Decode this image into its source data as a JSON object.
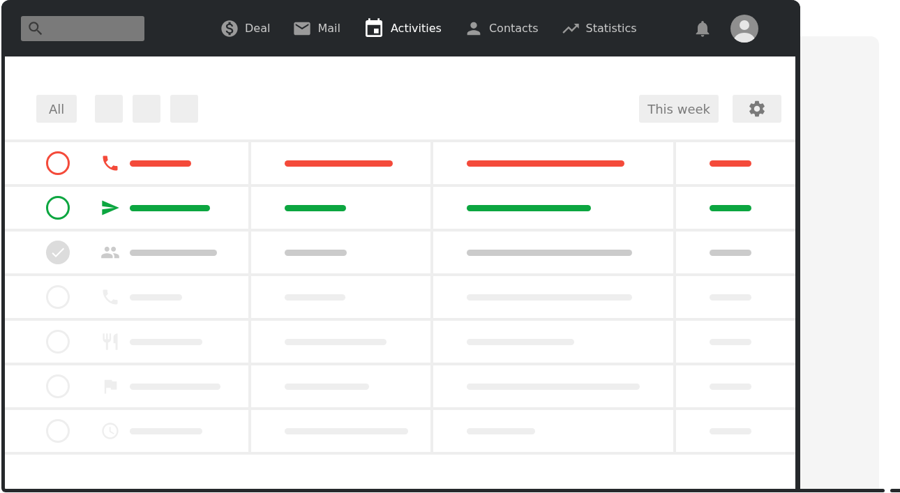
{
  "nav": [
    {
      "kind": "deal",
      "label": "Deal",
      "selected": false
    },
    {
      "kind": "mail",
      "label": "Mail",
      "selected": false
    },
    {
      "kind": "activities",
      "label": "Activities",
      "selected": true
    },
    {
      "kind": "contacts",
      "label": "Contacts",
      "selected": false
    },
    {
      "kind": "statistics",
      "label": "Statistics",
      "selected": false
    }
  ],
  "filters": [
    {
      "kind": "text",
      "label": "All"
    },
    {
      "kind": "blank"
    },
    {
      "kind": "blank"
    },
    {
      "kind": "blank"
    }
  ],
  "period": "This week",
  "rows": [
    {
      "kind": "call",
      "color": "#f44a3a",
      "checked": false
    },
    {
      "kind": "email",
      "color": "#0ca640",
      "checked": false
    },
    {
      "kind": "meeting",
      "color": "#cbcbcb",
      "checked": true
    },
    {
      "kind": "call",
      "color": "#eeeeee",
      "checked": false
    },
    {
      "kind": "lunch",
      "color": "#eeeeee",
      "checked": false
    },
    {
      "kind": "deadline",
      "color": "#eeeeee",
      "checked": false
    },
    {
      "kind": "time",
      "color": "#eeeeee",
      "checked": false
    }
  ]
}
